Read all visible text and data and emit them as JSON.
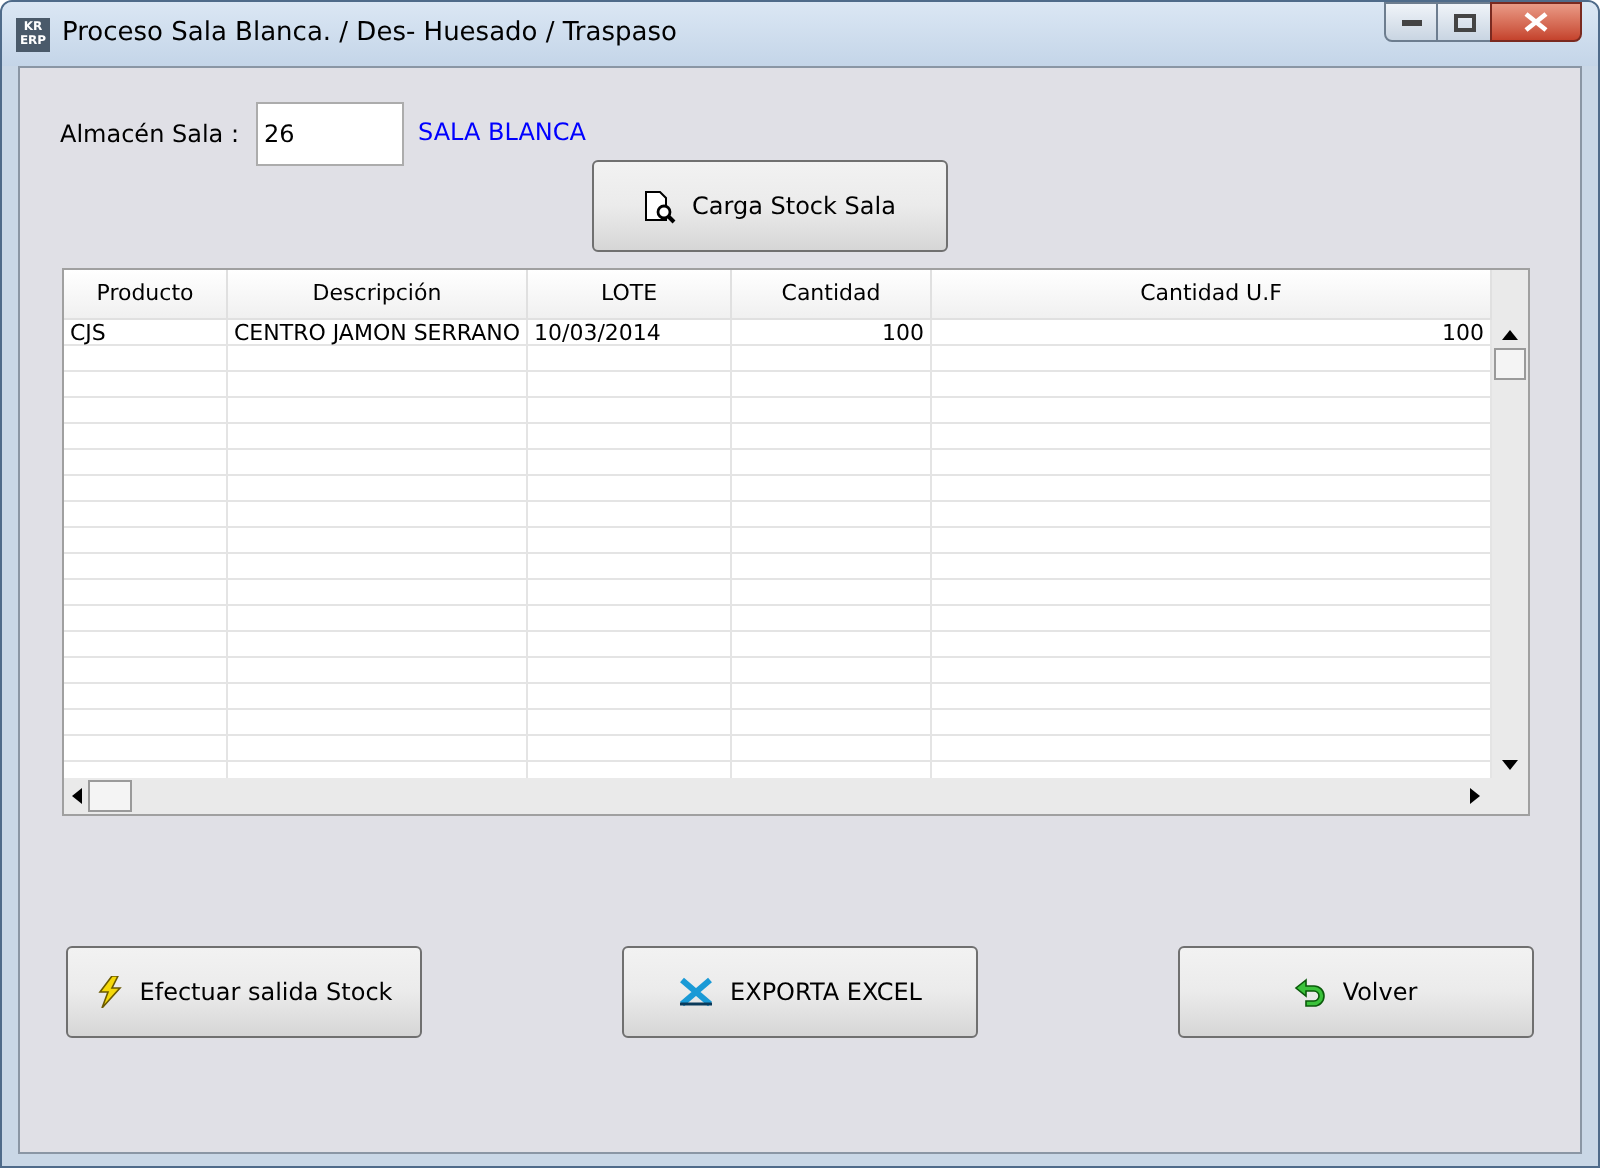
{
  "window": {
    "title": "Proceso Sala Blanca. / Des- Huesado / Traspaso",
    "app_icon_text": [
      "KR",
      "ERP"
    ]
  },
  "almacen": {
    "label": "Almacén Sala :",
    "value": "26",
    "name": "SALA BLANCA"
  },
  "load_button": {
    "label": "Carga Stock Sala"
  },
  "table": {
    "columns": [
      "Producto",
      "Descripción",
      "LOTE",
      "Cantidad",
      "Cantidad U.F"
    ],
    "rows": [
      [
        "CJS",
        "CENTRO JAMON SERRANO",
        "10/03/2014",
        "100",
        "100"
      ]
    ]
  },
  "buttons": [
    {
      "kind": "bolt",
      "label": "Efectuar salida Stock"
    },
    {
      "kind": "excel",
      "label": "EXPORTA EXCEL"
    },
    {
      "kind": "back",
      "label": "Volver"
    }
  ]
}
